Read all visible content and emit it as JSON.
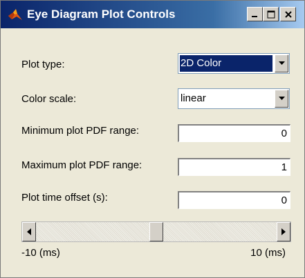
{
  "window": {
    "title": "Eye Diagram Plot Controls",
    "icon": "matlab-icon",
    "buttons": [
      "minimize-icon",
      "maximize-icon",
      "close-icon"
    ]
  },
  "controls": {
    "plot_type": {
      "label": "Plot type:",
      "value": "2D Color"
    },
    "color_scale": {
      "label": "Color scale:",
      "value": "linear"
    },
    "min_pdf": {
      "label": "Minimum plot PDF range:",
      "value": "0"
    },
    "max_pdf": {
      "label": "Maximum plot PDF range:",
      "value": "1"
    },
    "time_offset": {
      "label": "Plot time offset (s):",
      "value": "0"
    }
  },
  "slider": {
    "min_label": "-10 (ms)",
    "max_label": "10 (ms)",
    "position_fraction": 0.5
  },
  "colors": {
    "title_bar_start": "#0a246a",
    "title_bar_end": "#a6caf0",
    "selection": "#0a246a",
    "window_bg": "#ece9d8"
  }
}
